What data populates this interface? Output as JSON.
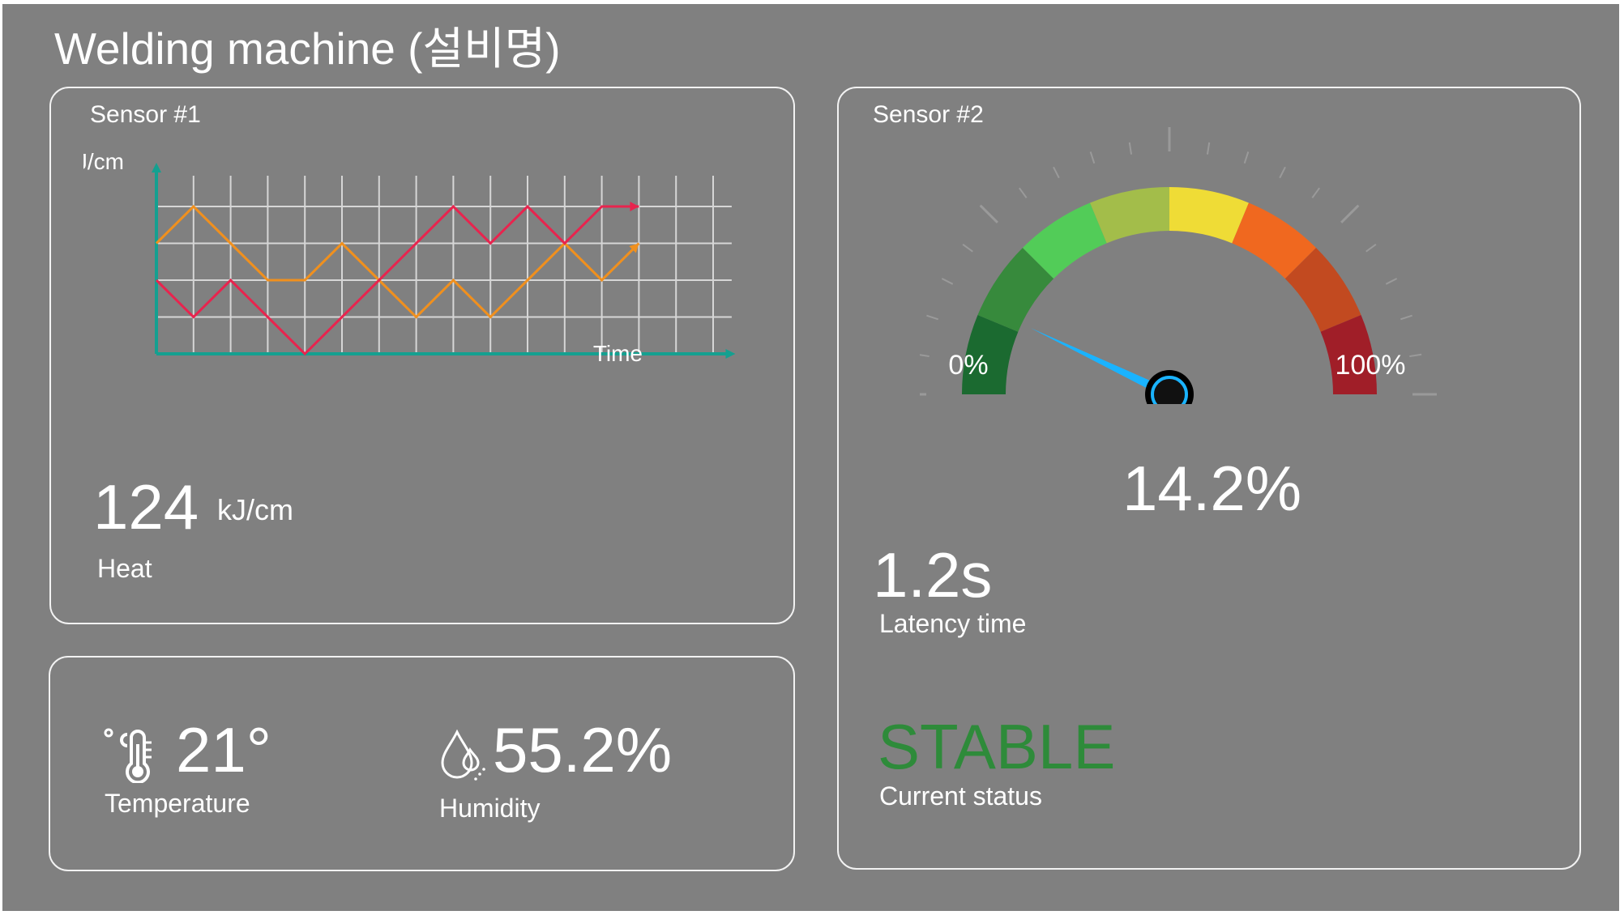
{
  "header": {
    "title": "Welding machine (설비명)"
  },
  "sensor1": {
    "title": "Sensor #1",
    "heat_value": "124",
    "heat_unit": "kJ/cm",
    "heat_label": "Heat",
    "chart_data": {
      "type": "line",
      "ylabel": "kJ/cm",
      "xlabel": "Time",
      "grid": true,
      "x": [
        0,
        1,
        2,
        3,
        4,
        5,
        6,
        7,
        8,
        9,
        10,
        11,
        12,
        13
      ],
      "ylim": [
        0,
        4
      ],
      "series": [
        {
          "color": "#f0901e",
          "values": [
            3,
            4,
            3,
            2,
            2,
            3,
            2,
            1,
            2,
            1,
            2,
            3,
            2,
            3
          ]
        },
        {
          "color": "#e8244e",
          "values": [
            2,
            1,
            2,
            1,
            0,
            1,
            2,
            3,
            4,
            3,
            4,
            3,
            4,
            4
          ]
        }
      ]
    }
  },
  "env": {
    "temperature_value": "21°",
    "temperature_label": "Temperature",
    "temperature_icon": "thermometer-celsius-icon",
    "humidity_value": "55.2%",
    "humidity_label": "Humidity",
    "humidity_icon": "water-drops-icon"
  },
  "sensor2": {
    "title": "Sensor #2",
    "gauge_min_label": "0%",
    "gauge_max_label": "100%",
    "gauge_value": 14.2,
    "gauge_value_text": "14.2%",
    "latency_value": "1.2s",
    "latency_label": "Latency time",
    "status_value": "STABLE",
    "status_label": "Current status",
    "status_color": "#2e8b3a",
    "gauge_colors": [
      "#1b6a30",
      "#378a3c",
      "#52cc58",
      "#a3bd4a",
      "#efdc36",
      "#f0681f",
      "#c24a20",
      "#a01e28"
    ],
    "needle_color": "#1ab3ff"
  }
}
